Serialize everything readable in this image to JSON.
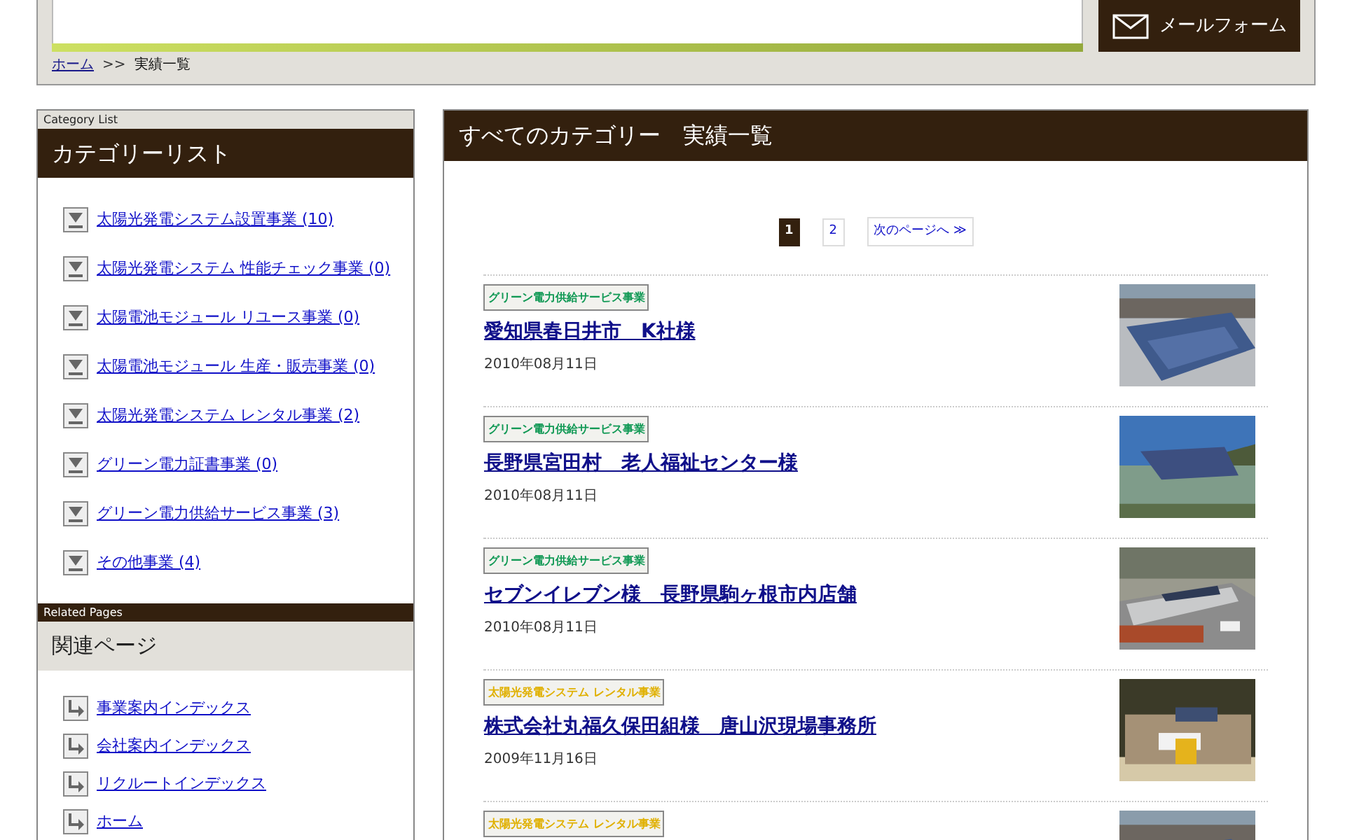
{
  "header": {
    "mail_button": "メールフォーム",
    "breadcrumb": [
      {
        "label": "ホーム",
        "kind": "link"
      },
      {
        "label": ">>",
        "kind": "separator"
      },
      {
        "label": "実績一覧",
        "kind": "current"
      }
    ]
  },
  "sidebar": {
    "category_caption": "Category List",
    "category_title": "カテゴリーリスト",
    "categories": [
      {
        "label": "太陽光発電システム設置事業 (10)"
      },
      {
        "label": "太陽光発電システム 性能チェック事業 (0)"
      },
      {
        "label": "太陽電池モジュール リユース事業 (0)"
      },
      {
        "label": "太陽電池モジュール 生産・販売事業 (0)"
      },
      {
        "label": "太陽光発電システム レンタル事業 (2)"
      },
      {
        "label": "グリーン電力証書事業 (0)"
      },
      {
        "label": "グリーン電力供給サービス事業 (3)"
      },
      {
        "label": "その他事業 (4)"
      }
    ],
    "related_caption": "Related Pages",
    "related_title": "関連ページ",
    "related": [
      {
        "label": "事業案内インデックス"
      },
      {
        "label": "会社案内インデックス"
      },
      {
        "label": "リクルートインデックス"
      },
      {
        "label": "ホーム"
      }
    ]
  },
  "main": {
    "title": "すべてのカテゴリー　実績一覧",
    "pagination": {
      "pages": [
        {
          "label": "1",
          "selected": true
        },
        {
          "label": "2",
          "selected": false
        }
      ],
      "next": "次のページへ ≫"
    },
    "entries": [
      {
        "tag": "グリーン電力供給サービス事業",
        "color": "#119955",
        "title": "愛知県春日井市　K社様",
        "date": "2010年08月11日"
      },
      {
        "tag": "グリーン電力供給サービス事業",
        "color": "#119955",
        "title": "長野県宮田村　老人福祉センター様",
        "date": "2010年08月11日"
      },
      {
        "tag": "グリーン電力供給サービス事業",
        "color": "#119955",
        "title": "セブンイレブン様　長野県駒ヶ根市内店舗",
        "date": "2010年08月11日"
      },
      {
        "tag": "太陽光発電システム レンタル事業",
        "color": "#e0b000",
        "title": "株式会社丸福久保田組様　唐山沢現場事務所",
        "date": "2009年11月16日"
      },
      {
        "tag": "太陽光発電システム レンタル事業",
        "color": "#e0b000"
      }
    ]
  }
}
